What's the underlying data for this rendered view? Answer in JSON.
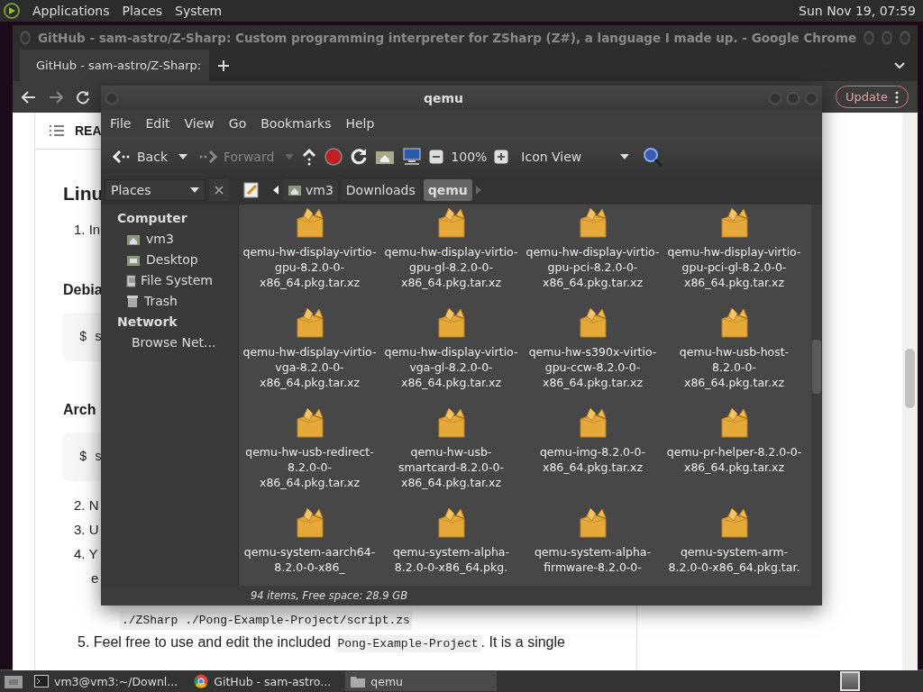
{
  "top_panel": {
    "menus": [
      "Applications",
      "Places",
      "System"
    ],
    "clock": "Sun Nov 19, 07:59"
  },
  "browser": {
    "title": "GitHub - sam-astro/Z-Sharp: Custom programming interpreter for ZSharp (Z#), a language I made up. - Google Chrome",
    "tabs": [
      {
        "label": "GitHub - sam-astro/Z-Sharp:",
        "selected": true
      }
    ],
    "update_button": "Update",
    "page": {
      "toc_label": "REA",
      "blocks": [
        {
          "kind": "heading",
          "text": "Linu"
        },
        {
          "kind": "step",
          "text": "1. In"
        },
        {
          "kind": "subheading",
          "text": "Debia"
        },
        {
          "kind": "code",
          "text": "$ s"
        },
        {
          "kind": "subheading",
          "text": "Arch"
        },
        {
          "kind": "code",
          "text": "$ s"
        },
        {
          "kind": "step",
          "text": "2. N"
        },
        {
          "kind": "step",
          "text": "3. U"
        },
        {
          "kind": "step",
          "text": "4. Y"
        },
        {
          "kind": "continuation",
          "text": "e"
        },
        {
          "kind": "code_line",
          "text": "./ZSharp ./Pong-Example-Project/script.zs"
        },
        {
          "kind": "paragraph",
          "parts": [
            {
              "text": "5. Feel free to use and edit the included ",
              "code": false
            },
            {
              "text": "Pong-Example-Project",
              "code": true
            },
            {
              "text": ". It is a single",
              "code": false
            }
          ]
        }
      ]
    }
  },
  "file_manager": {
    "title": "qemu",
    "menus": [
      "File",
      "Edit",
      "View",
      "Go",
      "Bookmarks",
      "Help"
    ],
    "toolbar": {
      "back": "Back",
      "forward": "Forward",
      "forward_disabled": true,
      "zoom": "100%",
      "view_mode": "Icon View"
    },
    "side_pane": {
      "label": "Places",
      "sections": [
        {
          "title": "Computer",
          "items": [
            {
              "label": "vm3",
              "kind": "home"
            },
            {
              "label": "Desktop",
              "kind": "desktop"
            },
            {
              "label": "File System",
              "kind": "drive"
            },
            {
              "label": "Trash",
              "kind": "trash"
            }
          ]
        },
        {
          "title": "Network",
          "items": [
            {
              "label": "Browse Net...",
              "kind": "network"
            }
          ]
        }
      ]
    },
    "path": [
      {
        "label": "vm3",
        "selected": false
      },
      {
        "label": "Downloads",
        "selected": false
      },
      {
        "label": "qemu",
        "selected": true
      }
    ],
    "files": [
      "qemu-hw-display-virtio-gpu-8.2.0-0-x86_64.pkg.tar.xz",
      "qemu-hw-display-virtio-gpu-gl-8.2.0-0-x86_64.pkg.tar.xz",
      "qemu-hw-display-virtio-gpu-pci-8.2.0-0-x86_64.pkg.tar.xz",
      "qemu-hw-display-virtio-gpu-pci-gl-8.2.0-0-x86_64.pkg.tar.xz",
      "qemu-hw-display-virtio-vga-8.2.0-0-x86_64.pkg.tar.xz",
      "qemu-hw-display-virtio-vga-gl-8.2.0-0-x86_64.pkg.tar.xz",
      "qemu-hw-s390x-virtio-gpu-ccw-8.2.0-0-x86_64.pkg.tar.xz",
      "qemu-hw-usb-host-8.2.0-0-x86_64.pkg.tar.xz",
      "qemu-hw-usb-redirect-8.2.0-0-x86_64.pkg.tar.xz",
      "qemu-hw-usb-smartcard-8.2.0-0-x86_64.pkg.tar.xz",
      "qemu-img-8.2.0-0-x86_64.pkg.tar.xz",
      "qemu-pr-helper-8.2.0-0-x86_64.pkg.tar.xz",
      "qemu-system-aarch64-8.2.0-0-x86_",
      "qemu-system-alpha-8.2.0-0-x86_64.pkg.",
      "qemu-system-alpha-firmware-8.2.0-0-",
      "qemu-system-arm-8.2.0-0-x86_64.pkg.tar."
    ],
    "status": "94 items, Free space: 28.9 GB"
  },
  "taskbar": {
    "items": [
      {
        "label": "vm3@vm3:~/Downl...",
        "kind": "terminal",
        "selected": false
      },
      {
        "label": "GitHub - sam-astro...",
        "kind": "chrome",
        "selected": false
      },
      {
        "label": "qemu",
        "kind": "folder",
        "selected": true
      }
    ]
  }
}
